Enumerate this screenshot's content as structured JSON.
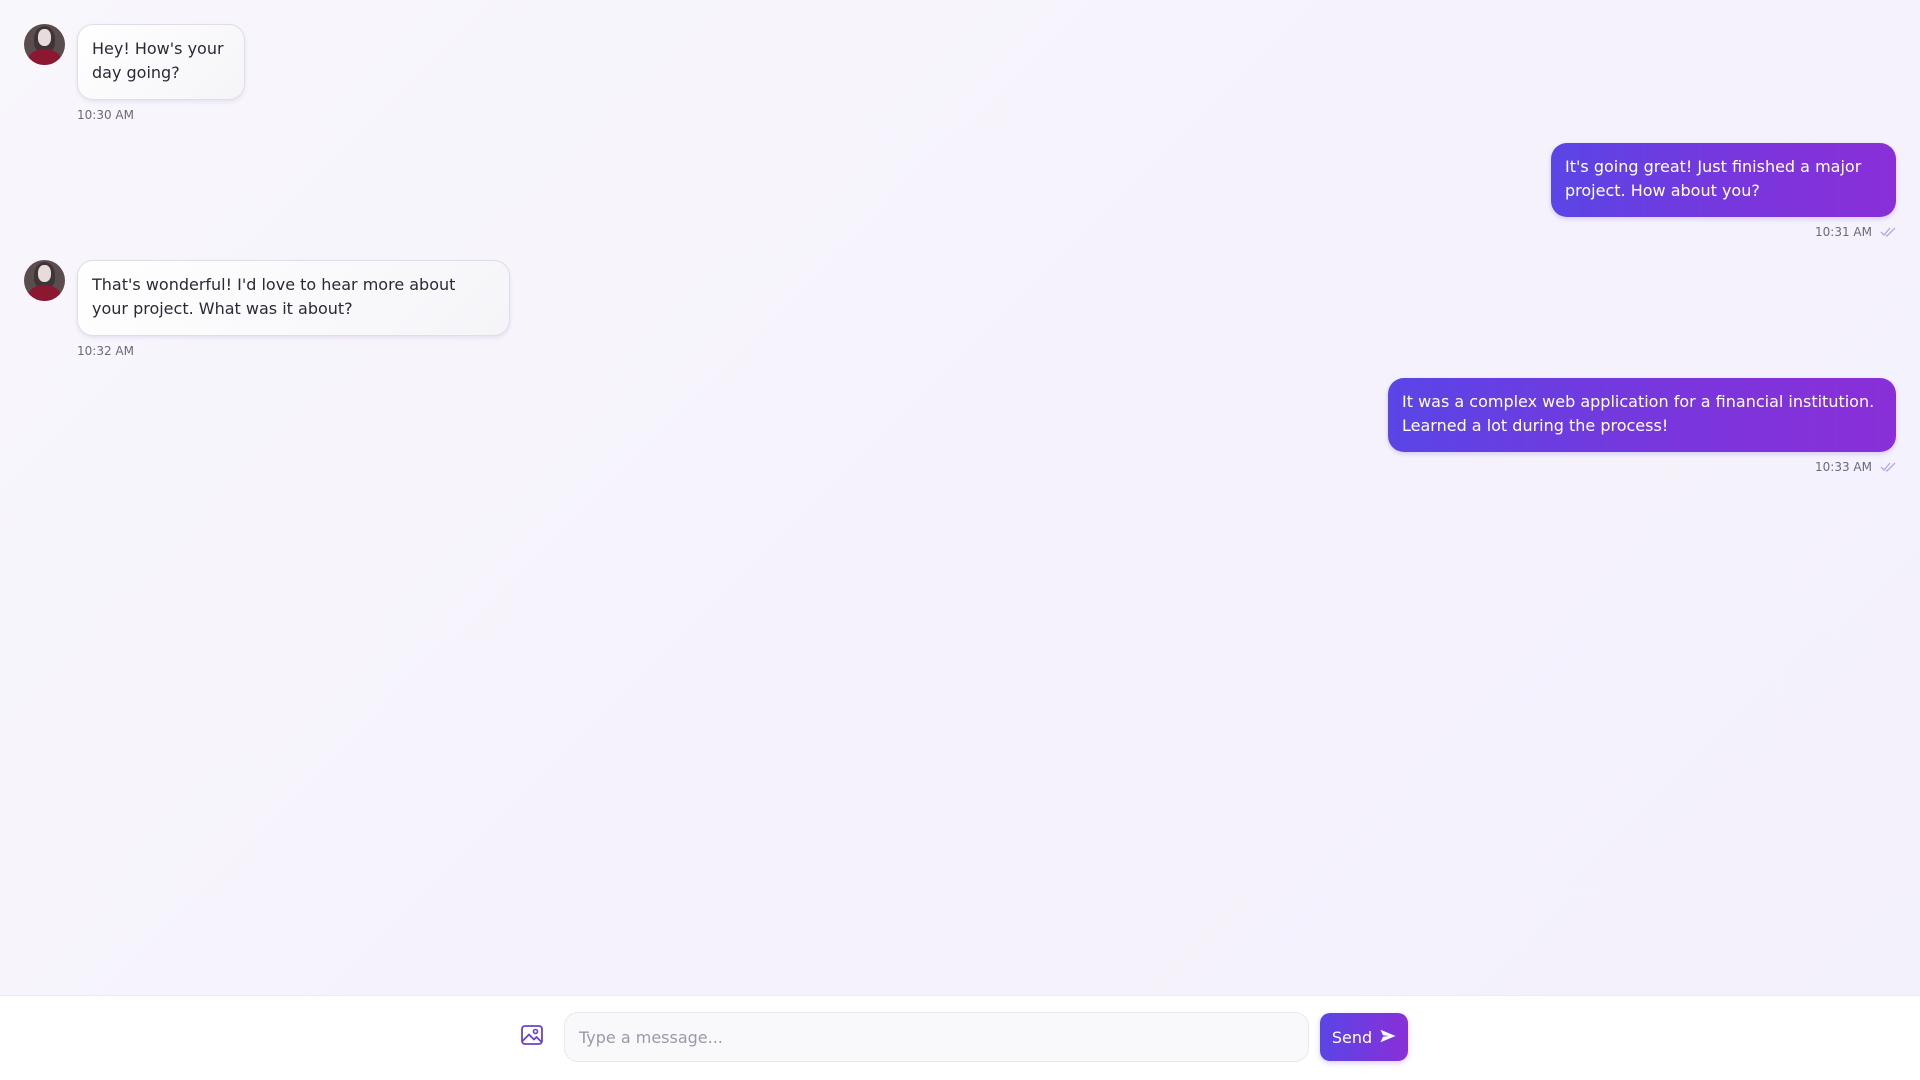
{
  "messages": [
    {
      "direction": "incoming",
      "text": "Hey! How's your day going?",
      "time": "10:30 AM"
    },
    {
      "direction": "outgoing",
      "text": "It's going great! Just finished a major project. How about you?",
      "time": "10:31 AM",
      "status_icon": "double-check-icon"
    },
    {
      "direction": "incoming",
      "text": "That's wonderful! I'd love to hear more about your project. What was it about?",
      "time": "10:32 AM"
    },
    {
      "direction": "outgoing",
      "text": "It was a complex web application for a financial institution. Learned a lot during the process!",
      "time": "10:33 AM",
      "status_icon": "double-check-icon"
    }
  ],
  "composer": {
    "attach_icon": "image-icon",
    "placeholder": "Type a message...",
    "value": "",
    "send_label": "Send",
    "send_icon": "send-icon"
  },
  "colors": {
    "accent_start": "#5a45e6",
    "accent_end": "#8a2fd8",
    "incoming_bubble": "#ffffff",
    "outgoing_text": "#ffffff"
  }
}
